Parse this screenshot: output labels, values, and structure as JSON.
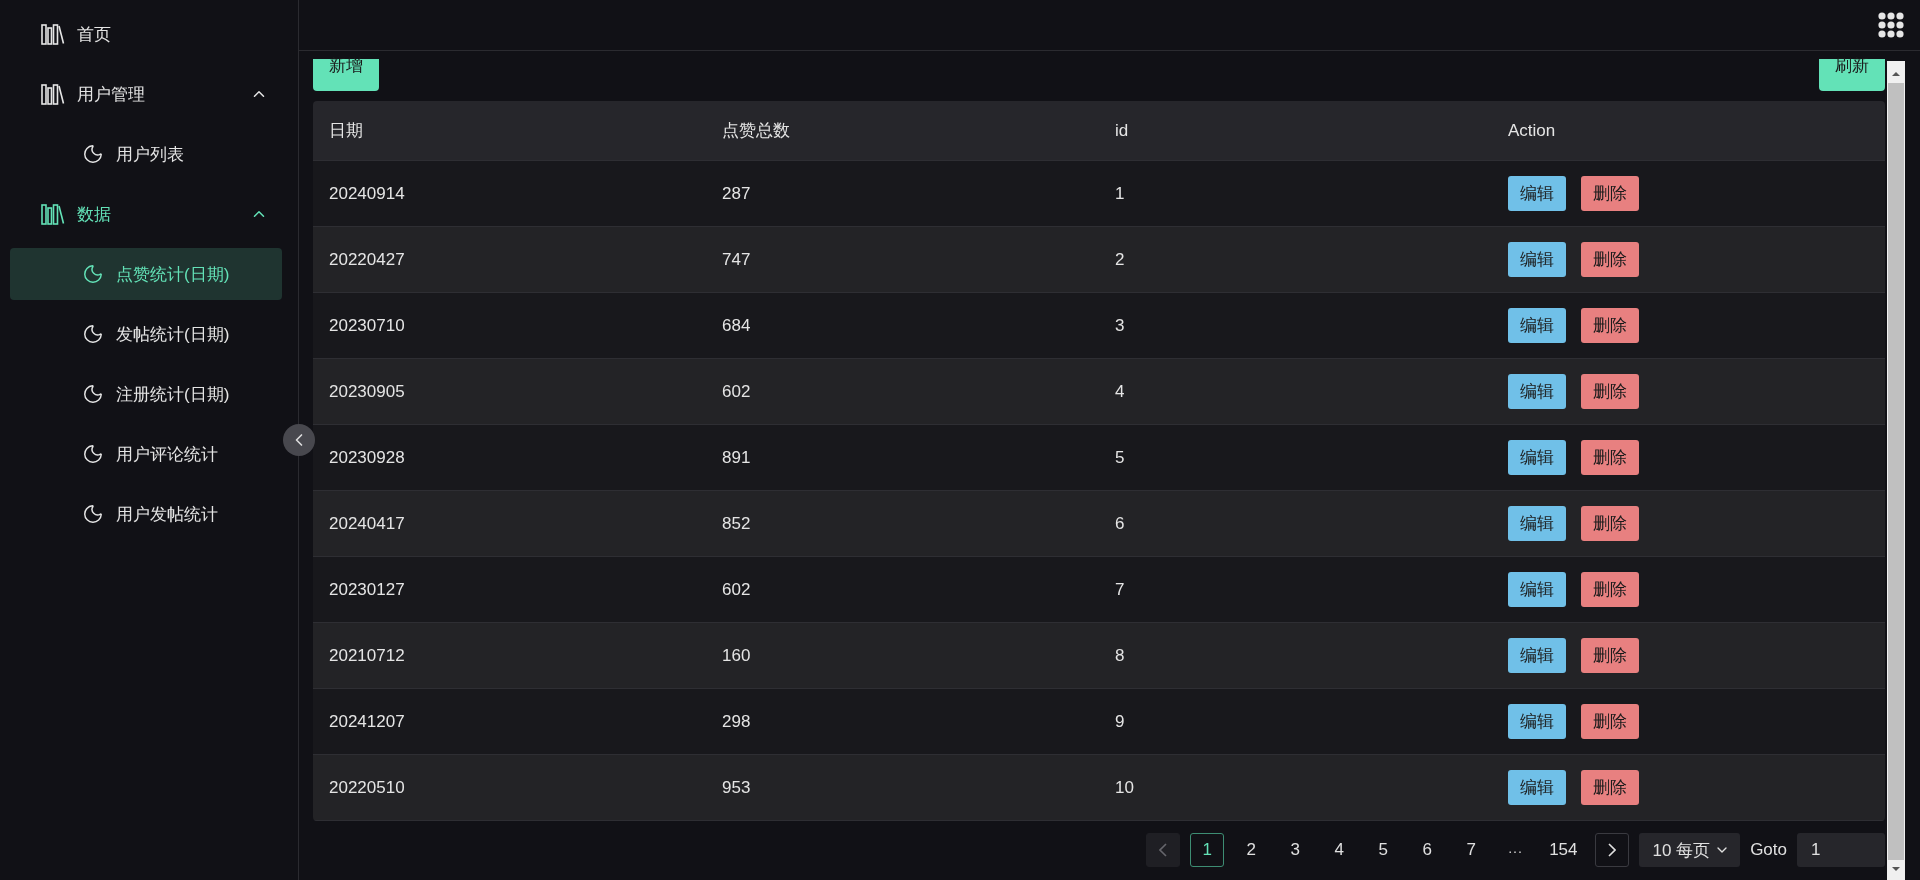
{
  "sidebar": {
    "items": [
      {
        "kind": "link",
        "label": "首页",
        "selected": false
      },
      {
        "kind": "group",
        "label": "用户管理",
        "selected": false,
        "expanded": true,
        "children": [
          {
            "kind": "leaf",
            "label": "用户列表",
            "selected": false
          }
        ]
      },
      {
        "kind": "group",
        "label": "数据",
        "selected": true,
        "expanded": true,
        "children": [
          {
            "kind": "leaf",
            "label": "点赞统计(日期)",
            "selected": true
          },
          {
            "kind": "leaf",
            "label": "发帖统计(日期)",
            "selected": false
          },
          {
            "kind": "leaf",
            "label": "注册统计(日期)",
            "selected": false
          },
          {
            "kind": "leaf",
            "label": "用户评论统计",
            "selected": false
          },
          {
            "kind": "leaf",
            "label": "用户发帖统计",
            "selected": false
          }
        ]
      }
    ]
  },
  "toolbar": {
    "add_button": "新增",
    "refresh_button": "刷新"
  },
  "table": {
    "columns": [
      "日期",
      "点赞总数",
      "id",
      "Action"
    ],
    "rows": [
      {
        "cells": [
          "20240914",
          "287",
          "1"
        ],
        "actions": [
          "编辑",
          "删除"
        ]
      },
      {
        "cells": [
          "20220427",
          "747",
          "2"
        ],
        "actions": [
          "编辑",
          "删除"
        ]
      },
      {
        "cells": [
          "20230710",
          "684",
          "3"
        ],
        "actions": [
          "编辑",
          "删除"
        ]
      },
      {
        "cells": [
          "20230905",
          "602",
          "4"
        ],
        "actions": [
          "编辑",
          "删除"
        ]
      },
      {
        "cells": [
          "20230928",
          "891",
          "5"
        ],
        "actions": [
          "编辑",
          "删除"
        ]
      },
      {
        "cells": [
          "20240417",
          "852",
          "6"
        ],
        "actions": [
          "编辑",
          "删除"
        ]
      },
      {
        "cells": [
          "20230127",
          "602",
          "7"
        ],
        "actions": [
          "编辑",
          "删除"
        ]
      },
      {
        "cells": [
          "20210712",
          "160",
          "8"
        ],
        "actions": [
          "编辑",
          "删除"
        ]
      },
      {
        "cells": [
          "20241207",
          "298",
          "9"
        ],
        "actions": [
          "编辑",
          "删除"
        ]
      },
      {
        "cells": [
          "20220510",
          "953",
          "10"
        ],
        "actions": [
          "编辑",
          "删除"
        ]
      }
    ]
  },
  "pagination": {
    "prev": {
      "disabled": true
    },
    "next": {
      "disabled": false
    },
    "pages": [
      {
        "kind": "page",
        "label": "1",
        "selected": true
      },
      {
        "kind": "page",
        "label": "2",
        "selected": false
      },
      {
        "kind": "page",
        "label": "3",
        "selected": false
      },
      {
        "kind": "page",
        "label": "4",
        "selected": false
      },
      {
        "kind": "page",
        "label": "5",
        "selected": false
      },
      {
        "kind": "page",
        "label": "6",
        "selected": false
      },
      {
        "kind": "page",
        "label": "7",
        "selected": false
      },
      {
        "kind": "ellipsis",
        "label": "···"
      },
      {
        "kind": "page",
        "label": "154",
        "selected": false
      }
    ],
    "page_size": "10 每页",
    "goto_label": "Goto",
    "goto_value": "1"
  }
}
